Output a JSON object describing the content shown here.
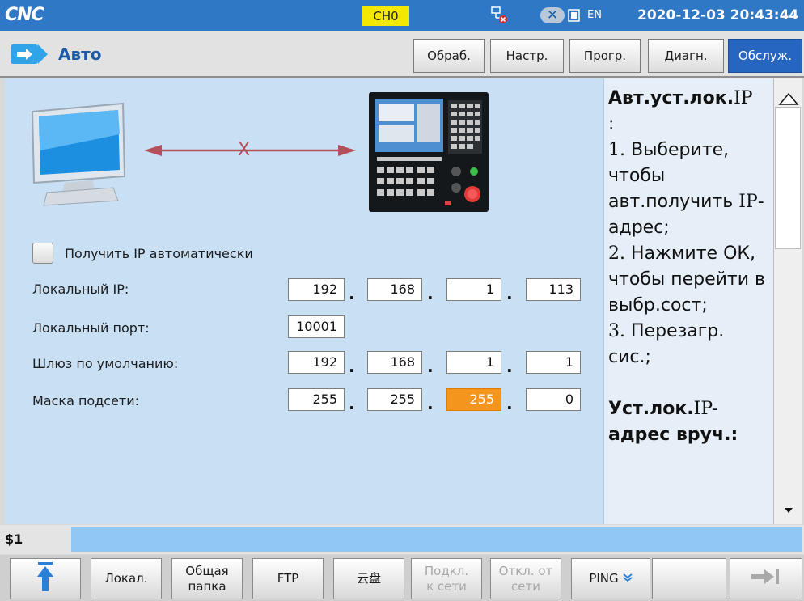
{
  "statusbar": {
    "logo": "CNC",
    "channel": "CH0",
    "language": "EN",
    "datetime": "2020-12-03 20:43:44"
  },
  "header": {
    "mode_title": "Авто",
    "tabs": [
      {
        "label": "Обраб.",
        "active": false
      },
      {
        "label": "Настр.",
        "active": false
      },
      {
        "label": "Прогр.",
        "active": false
      },
      {
        "label": "Диагн.",
        "active": false
      },
      {
        "label": "Обслуж.",
        "active": true
      }
    ]
  },
  "diagram": {
    "disconnect_mark": "X"
  },
  "form": {
    "auto_ip_label": "Получить IP автоматически",
    "auto_ip_checked": false,
    "local_ip_label": "Локальный IP:",
    "local_ip": [
      "192",
      "168",
      "1",
      "113"
    ],
    "local_port_label": "Локальный порт:",
    "local_port": "10001",
    "gateway_label": "Шлюз по умолчанию:",
    "gateway": [
      "192",
      "168",
      "1",
      "1"
    ],
    "subnet_label": "Маска подсети:",
    "subnet": [
      "255",
      "255",
      "255",
      "0"
    ],
    "dot": "."
  },
  "help": {
    "h1_bold": "Авт.уст.лок.",
    "h1_rest": "IP",
    "colon": ":",
    "l1": "1.",
    "l1_text": " Выберите, чтобы авт.получить ",
    "l1_ip": "IP",
    "l1_end": "-адрес;",
    "l2": "2.",
    "l2_text": " Нажмите ОК, чтобы перейти в выбр.сост;",
    "l3": "3.",
    "l3_text": " Перезагр. сис.;",
    "h2_bold": "Уст.лок.",
    "h2_rest": "IP-",
    "h2_line2": "адрес вруч.:"
  },
  "command": {
    "prompt": "$1"
  },
  "softkeys": [
    {
      "label": "",
      "icon": "up-arrow-icon",
      "enabled": true
    },
    {
      "label": "Локал.",
      "enabled": true
    },
    {
      "label": "Общая папка",
      "enabled": true
    },
    {
      "label": "FTP",
      "enabled": true
    },
    {
      "label": "云盘",
      "enabled": true
    },
    {
      "label": "Подкл. к сети",
      "enabled": false
    },
    {
      "label": "Откл. от сети",
      "enabled": false
    },
    {
      "label": "PING",
      "icon": "double-chevron-down-icon",
      "enabled": true
    },
    {
      "label": "",
      "enabled": true
    },
    {
      "label": "",
      "icon": "next-page-icon",
      "enabled": true
    }
  ],
  "colors": {
    "accent": "#2766c0",
    "highlight_field": "#f4961d",
    "panel": "#c8dff4",
    "channel_badge": "#f3e800"
  }
}
